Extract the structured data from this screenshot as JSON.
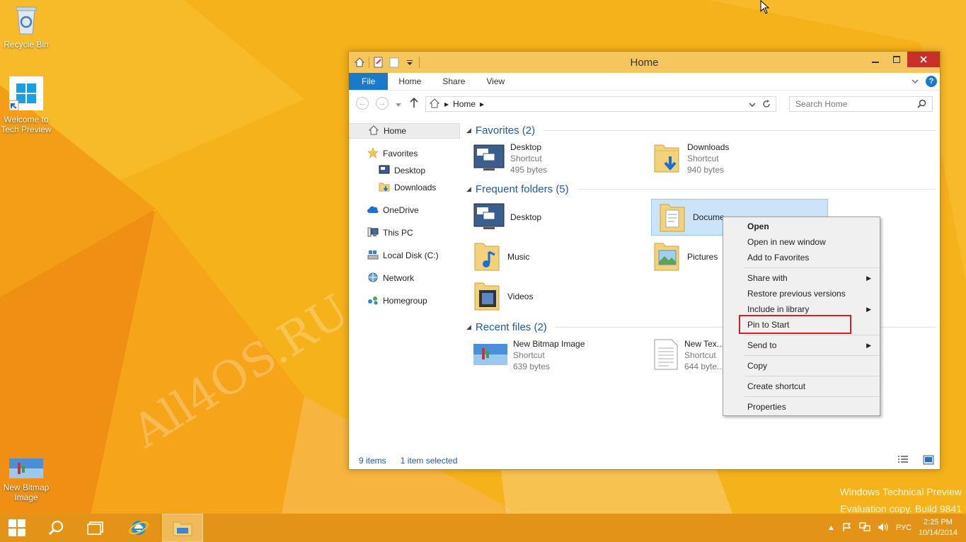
{
  "desktop": {
    "icons": [
      {
        "label": "Recycle Bin"
      },
      {
        "label": "Welcome to Tech Preview"
      },
      {
        "label": "New Bitmap Image"
      }
    ],
    "watermark": "All4OS.RU",
    "build_line1": "Windows Technical Preview",
    "build_line2": "Evaluation copy. Build 9841"
  },
  "window": {
    "title": "Home",
    "tabs": [
      "File",
      "Home",
      "Share",
      "View"
    ],
    "address": {
      "location": "Home"
    },
    "search_placeholder": "Search Home",
    "nav": {
      "home": "Home",
      "favorites": "Favorites",
      "desktop": "Desktop",
      "downloads": "Downloads",
      "onedrive": "OneDrive",
      "thispc": "This PC",
      "localdisk": "Local Disk (C:)",
      "network": "Network",
      "homegroup": "Homegroup"
    },
    "groups": {
      "favorites": "Favorites (2)",
      "frequent": "Frequent folders (5)",
      "recent": "Recent files (2)"
    },
    "items": {
      "fav_desktop": {
        "name": "Desktop",
        "type": "Shortcut",
        "size": "495 bytes"
      },
      "fav_downloads": {
        "name": "Downloads",
        "type": "Shortcut",
        "size": "940 bytes"
      },
      "freq_desktop": {
        "name": "Desktop"
      },
      "freq_documents": {
        "name": "Docume..."
      },
      "freq_music": {
        "name": "Music"
      },
      "freq_pictures": {
        "name": "Pictures"
      },
      "freq_videos": {
        "name": "Videos"
      },
      "rec_bitmap": {
        "name": "New Bitmap Image",
        "type": "Shortcut",
        "size": "639 bytes"
      },
      "rec_text": {
        "name": "New Tex...",
        "type": "Shortcut",
        "size": "644 byte..."
      }
    },
    "status": {
      "count": "9 items",
      "selected": "1 item selected"
    }
  },
  "context_menu": {
    "open": "Open",
    "open_new_window": "Open in new window",
    "add_favorites": "Add to Favorites",
    "share_with": "Share with",
    "restore_versions": "Restore previous versions",
    "include_library": "Include in library",
    "pin_start": "Pin to Start",
    "send_to": "Send to",
    "copy": "Copy",
    "create_shortcut": "Create shortcut",
    "properties": "Properties"
  },
  "taskbar": {
    "language": "РУС",
    "time": "2:25 PM",
    "date": "10/14/2014"
  },
  "colors": {
    "accent": "#1979ca",
    "titlebar": "#f5c65d",
    "taskbar": "#e39418",
    "highlight": "#d42020"
  }
}
